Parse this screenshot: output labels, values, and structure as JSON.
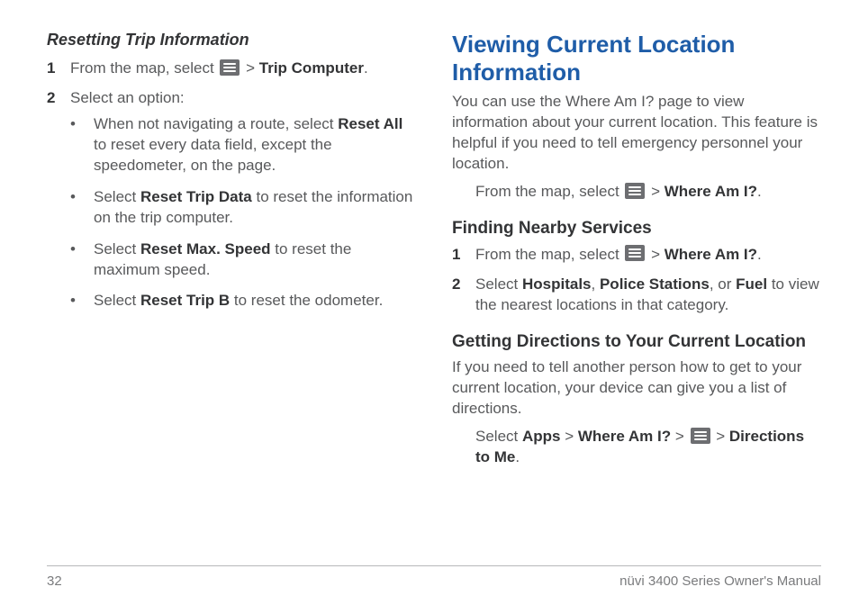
{
  "left": {
    "heading": "Resetting Trip Information",
    "step1_prefix": "From the map, select ",
    "step1_sep": " > ",
    "step1_bold": "Trip Computer",
    "step1_suffix": ".",
    "step2": "Select an option:",
    "bullets": [
      {
        "pre": "When not navigating a route, select ",
        "bold": "Reset All",
        "post": " to reset every data field, except the speedometer, on the page."
      },
      {
        "pre": "Select ",
        "bold": "Reset Trip Data",
        "post": " to reset the information on the trip computer."
      },
      {
        "pre": "Select ",
        "bold": "Reset Max. Speed",
        "post": " to reset the maximum speed."
      },
      {
        "pre": "Select ",
        "bold": "Reset Trip B",
        "post": " to reset the odometer."
      }
    ]
  },
  "right": {
    "heading": "Viewing Current Location Information",
    "intro": "You can use the Where Am I? page to view information about your current location. This feature is helpful if you need to tell emergency personnel your location.",
    "intro_step_prefix": "From the map, select ",
    "intro_step_sep": " > ",
    "intro_step_bold": "Where Am I?",
    "intro_step_suffix": ".",
    "sub1": "Finding Nearby Services",
    "s1_step1_prefix": "From the map, select ",
    "s1_step1_sep": " > ",
    "s1_step1_bold": "Where Am I?",
    "s1_step1_suffix": ".",
    "s1_step2_pre": "Select ",
    "s1_step2_b1": "Hospitals",
    "s1_step2_c1": ", ",
    "s1_step2_b2": "Police Stations",
    "s1_step2_c2": ", or ",
    "s1_step2_b3": "Fuel",
    "s1_step2_post": " to view the nearest locations in that category.",
    "sub2": "Getting Directions to Your Current Location",
    "s2_intro": "If you need to tell another person how to get to your current location, your device can give you a list of directions.",
    "s2_step_pre": "Select ",
    "s2_step_b1": "Apps",
    "s2_step_sep": " > ",
    "s2_step_b2": "Where Am I?",
    "s2_step_b3": "Directions to Me",
    "s2_step_suffix": "."
  },
  "footer": {
    "page": "32",
    "title": "nüvi 3400 Series Owner's Manual"
  }
}
